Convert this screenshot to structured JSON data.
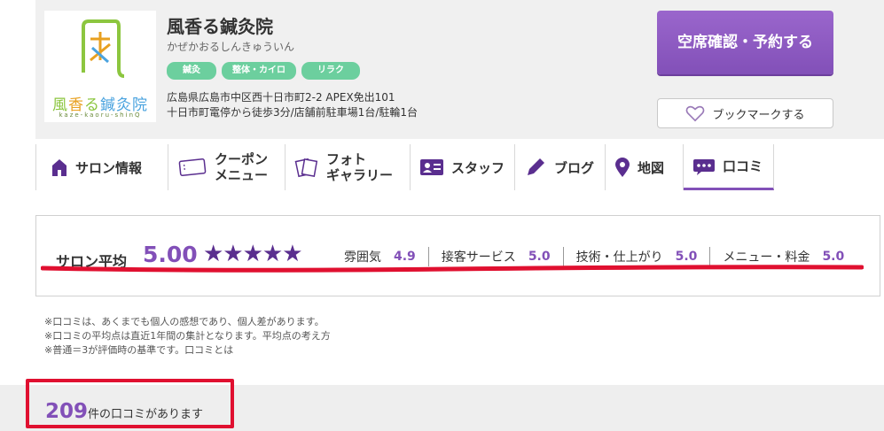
{
  "salon": {
    "name": "風香る鍼灸院",
    "kana": "かぜかおるしんきゅういん",
    "logo_text_parts": [
      "風",
      "香",
      "る",
      "鍼灸院"
    ],
    "logo_sub": "kaze-kaoru-shinQ",
    "tags": [
      "鍼灸",
      "整体・カイロ",
      "リラク"
    ],
    "address_line1": "広島県広島市中区西十日市町2-2 APEX免出101",
    "address_line2": "十日市町電停から徒歩3分/店舗前駐車場1台/駐輪1台"
  },
  "actions": {
    "reserve": "空席確認・予約する",
    "bookmark": "ブックマークする"
  },
  "nav": {
    "salon_info": "サロン情報",
    "coupon_line1": "クーポン",
    "coupon_line2": "メニュー",
    "photo_line1": "フォト",
    "photo_line2": "ギャラリー",
    "staff": "スタッフ",
    "blog": "ブログ",
    "map": "地図",
    "reviews": "口コミ"
  },
  "rating": {
    "label": "サロン平均",
    "average": "5.00",
    "stars": "★★★★★",
    "star_count": 5,
    "items": [
      {
        "label": "雰囲気",
        "value": "4.9"
      },
      {
        "label": "接客サービス",
        "value": "5.0"
      },
      {
        "label": "技術・仕上がり",
        "value": "5.0"
      },
      {
        "label": "メニュー・料金",
        "value": "5.0"
      }
    ]
  },
  "notes": {
    "line1": "※口コミは、あくまでも個人の感想であり、個人差があります。",
    "line2": "※口コミの平均点は直近1年間の集計となります。平均点の考え方",
    "line3": "※普通＝3が評価時の基準です。口コミとは"
  },
  "review_count": {
    "number": "209",
    "suffix": "件の口コミがあります"
  },
  "colors": {
    "accent": "#8250b8",
    "tag": "#6ccf9e",
    "highlight_red": "#e01030"
  }
}
